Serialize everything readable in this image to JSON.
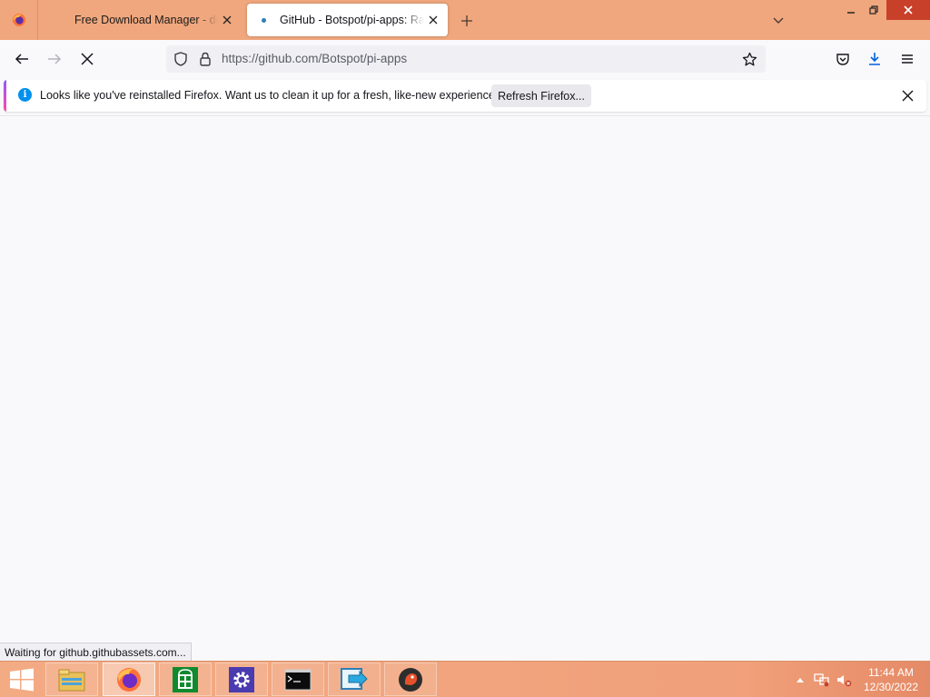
{
  "browser": {
    "tabs": [
      {
        "title": "Free Download Manager - download",
        "active": false,
        "icon": "free-download-manager-icon"
      },
      {
        "title": "GitHub - Botspot/pi-apps: Raspberry",
        "active": true,
        "icon": "loading-dot-icon"
      }
    ],
    "url": "https://github.com/Botspot/pi-apps",
    "status_text": "Waiting for github.githubassets.com..."
  },
  "notification": {
    "message": "Looks like you've reinstalled Firefox. Want us to clean it up for a fresh, like-new experience?",
    "button_label": "Refresh Firefox..."
  },
  "taskbar": {
    "apps": [
      {
        "name": "file-explorer",
        "icon": "folder-icon"
      },
      {
        "name": "firefox",
        "icon": "firefox-icon",
        "active": true
      },
      {
        "name": "store",
        "icon": "store-icon"
      },
      {
        "name": "settings",
        "icon": "gear-icon"
      },
      {
        "name": "command-prompt",
        "icon": "terminal-icon"
      },
      {
        "name": "remote-app",
        "icon": "remote-arrow-icon"
      },
      {
        "name": "app-unknown",
        "icon": "bird-icon"
      }
    ],
    "clock": {
      "time": "11:44 AM",
      "date": "12/30/2022"
    }
  },
  "colors": {
    "titlebar": "#f0a77d",
    "taskbar": "#f0a07a",
    "close_button": "#c8402a",
    "accent_blue": "#0090ed"
  }
}
